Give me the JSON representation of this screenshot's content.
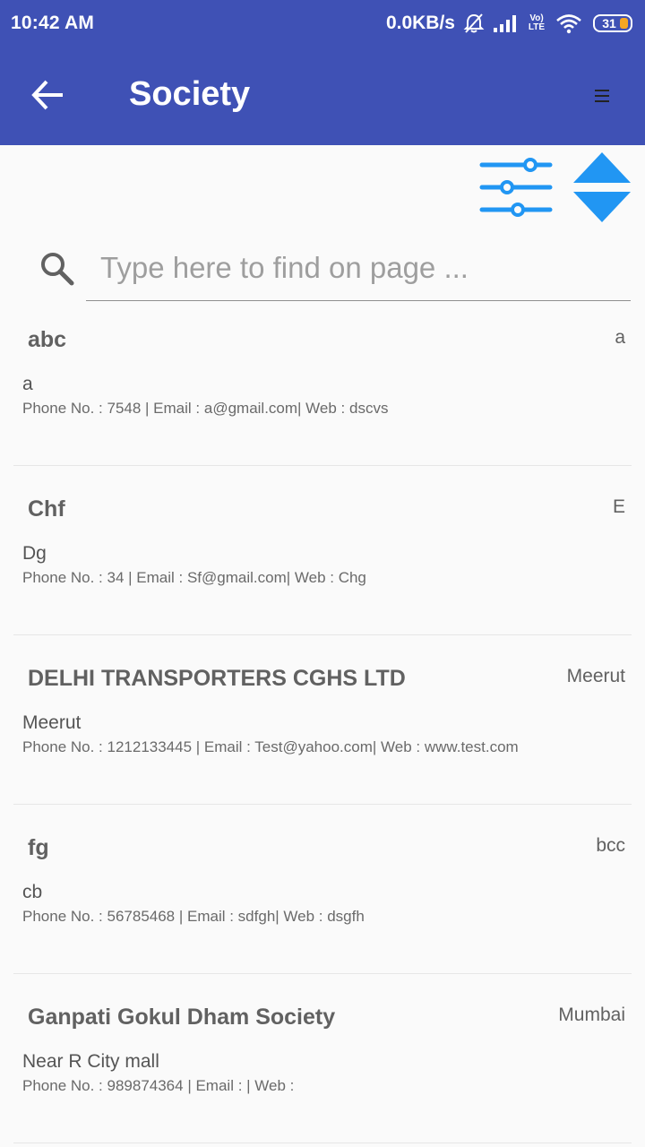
{
  "status_bar": {
    "time": "10:42 AM",
    "network_speed": "0.0KB/s",
    "volte_label": "Vo) LTE",
    "battery": "31",
    "icons": [
      "mute-alarm-icon",
      "signal-icon",
      "volte-icon",
      "wifi-icon",
      "battery-icon"
    ]
  },
  "app_bar": {
    "title": "Society",
    "back_icon": "back-arrow-icon",
    "menu_icon": "menu-icon"
  },
  "toolbar": {
    "filter_icon": "filter-sliders-icon",
    "sort_icon": "sort-up-down-icon",
    "accent_color": "#2196f3"
  },
  "search": {
    "placeholder": "Type here to find on page ...",
    "value": ""
  },
  "societies": [
    {
      "name": "abc",
      "city": "a",
      "address": "a",
      "details": "Phone No. : 7548 | Email : a@gmail.com| Web : dscvs"
    },
    {
      "name": "Chf",
      "city": "E",
      "address": "Dg",
      "details": "Phone No. : 34 | Email : Sf@gmail.com| Web : Chg"
    },
    {
      "name": "DELHI TRANSPORTERS CGHS LTD",
      "city": "Meerut",
      "address": "Meerut",
      "details": "Phone No. : 1212133445 | Email : Test@yahoo.com| Web : www.test.com"
    },
    {
      "name": "fg",
      "city": "bcc",
      "address": "cb",
      "details": "Phone No. : 56785468 | Email : sdfgh| Web : dsgfh"
    },
    {
      "name": "Ganpati Gokul Dham Society",
      "city": "Mumbai",
      "address": "Near R City mall",
      "details": "Phone No. : 989874364 | Email : | Web :"
    }
  ],
  "colors": {
    "primary": "#3f51b5",
    "accent": "#2196f3",
    "background": "#fafafa"
  }
}
